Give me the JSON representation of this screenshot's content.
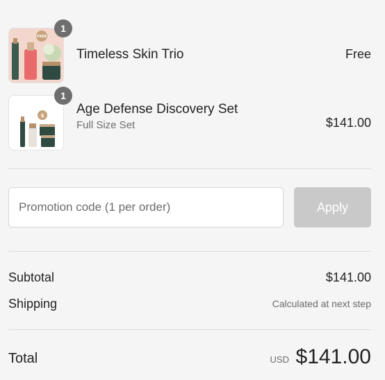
{
  "cart": {
    "items": [
      {
        "title": "Timeless Skin Trio",
        "subtitle": "",
        "price": "Free",
        "quantity": "1",
        "thumb_badge": "FREE"
      },
      {
        "title": "Age Defense Discovery Set",
        "subtitle": "Full Size Set",
        "price": "$141.00",
        "quantity": "1",
        "thumb_badge": "$"
      }
    ]
  },
  "promo": {
    "placeholder": "Promotion code (1 per order)",
    "value": "",
    "apply_label": "Apply"
  },
  "summary": {
    "subtotal_label": "Subtotal",
    "subtotal_value": "$141.00",
    "shipping_label": "Shipping",
    "shipping_value": "Calculated at next step",
    "total_label": "Total",
    "currency": "USD",
    "total_value": "$141.00"
  },
  "colors": {
    "background": "#f5f5f5",
    "badge": "#6e6e6e",
    "apply_disabled": "#c9c9c9",
    "muted_text": "#6b6b6b"
  }
}
